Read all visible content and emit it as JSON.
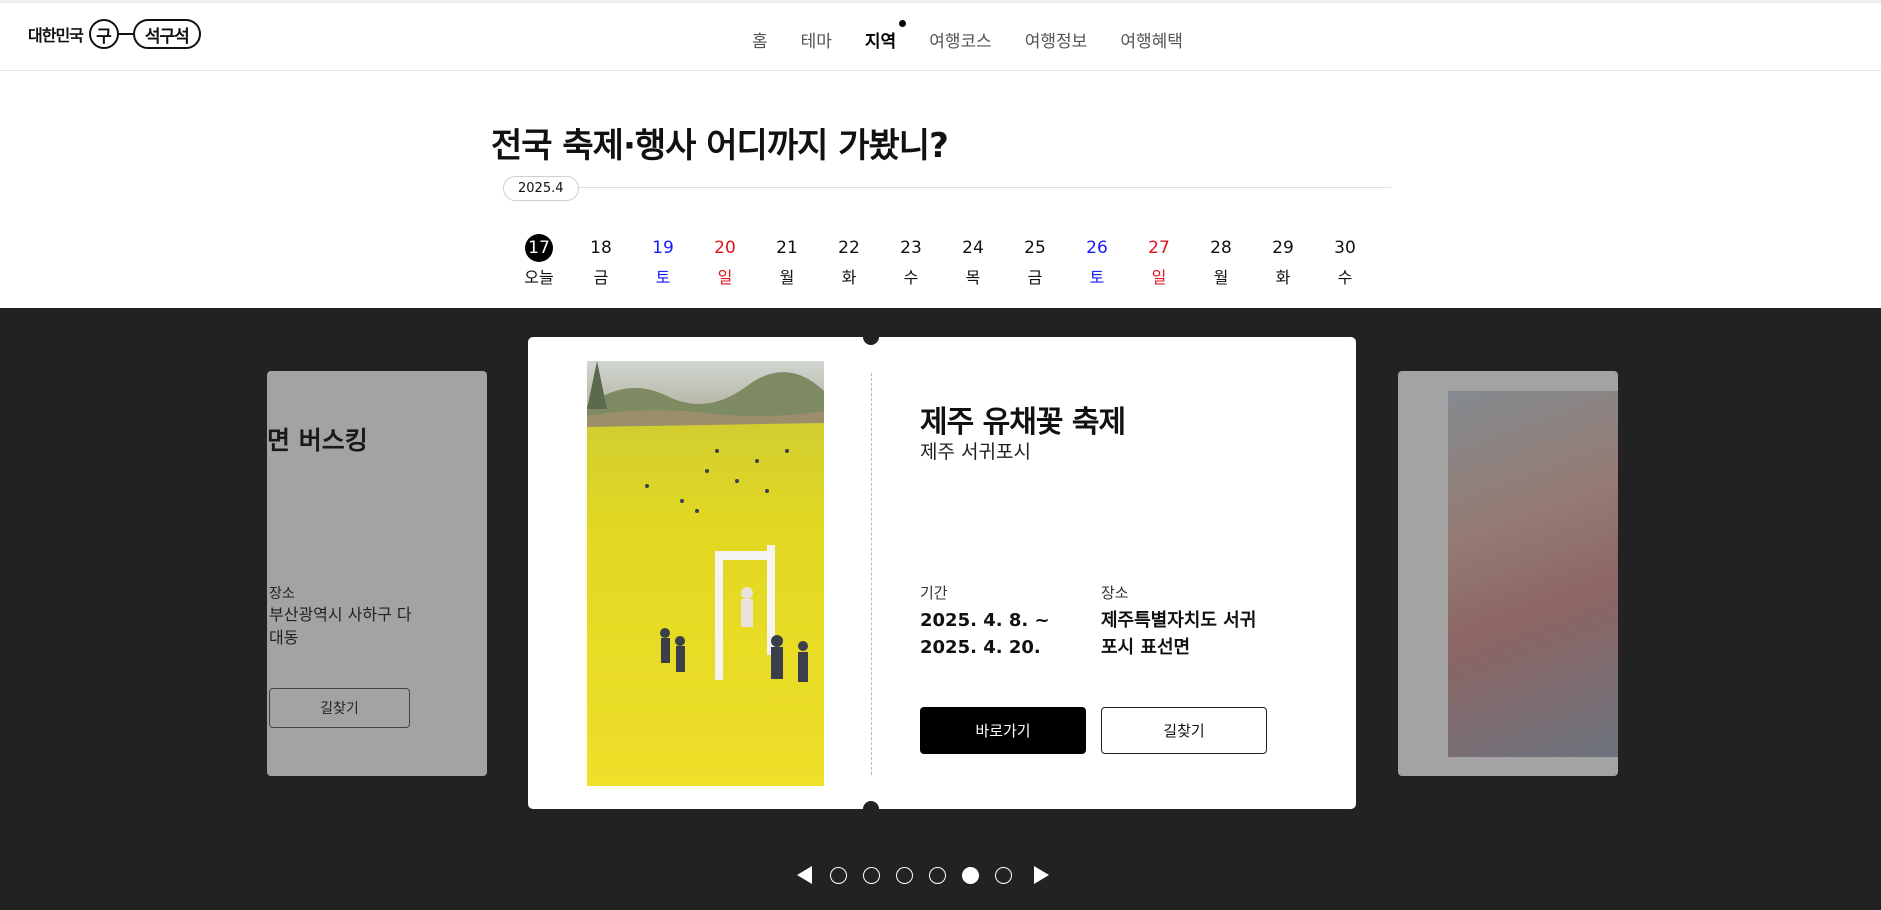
{
  "header": {
    "logo": {
      "prefix": "대한민국",
      "circle": "구",
      "pill": "석구석"
    },
    "nav": [
      "홈",
      "테마",
      "지역",
      "여행코스",
      "여행정보",
      "여행혜택"
    ],
    "nav_active_index": 2
  },
  "section": {
    "title_bold": "전국",
    "title_rest": " 축제·행사 어디까지 가봤니?",
    "month": "2025.4"
  },
  "dates": [
    {
      "num": "17",
      "day": "오늘",
      "type": "today"
    },
    {
      "num": "18",
      "day": "금",
      "type": "weekday"
    },
    {
      "num": "19",
      "day": "토",
      "type": "sat"
    },
    {
      "num": "20",
      "day": "일",
      "type": "sun"
    },
    {
      "num": "21",
      "day": "월",
      "type": "weekday"
    },
    {
      "num": "22",
      "day": "화",
      "type": "weekday"
    },
    {
      "num": "23",
      "day": "수",
      "type": "weekday"
    },
    {
      "num": "24",
      "day": "목",
      "type": "weekday"
    },
    {
      "num": "25",
      "day": "금",
      "type": "weekday"
    },
    {
      "num": "26",
      "day": "토",
      "type": "sat"
    },
    {
      "num": "27",
      "day": "일",
      "type": "sun"
    },
    {
      "num": "28",
      "day": "월",
      "type": "weekday"
    },
    {
      "num": "29",
      "day": "화",
      "type": "weekday"
    },
    {
      "num": "30",
      "day": "수",
      "type": "weekday"
    }
  ],
  "prev_card": {
    "title": "면 버스킹",
    "place_label": "장소",
    "place": "부산광역시 사하구 다대동",
    "directions": "길찾기"
  },
  "card": {
    "title": "제주 유채꽃 축제",
    "region": "제주 서귀포시",
    "period_label": "기간",
    "period_start": "2025. 4. 8. ~",
    "period_end": "2025. 4. 20.",
    "place_label": "장소",
    "place_line1": "제주특별자치도 서귀",
    "place_line2": "포시 표선면",
    "go_button": "바로가기",
    "directions_button": "길찾기"
  },
  "pager": {
    "count": 6,
    "active_index": 4
  },
  "colors": {
    "saturday": "#1a1aff",
    "sunday": "#e0141e",
    "band": "#222222",
    "accent": "#000000"
  }
}
